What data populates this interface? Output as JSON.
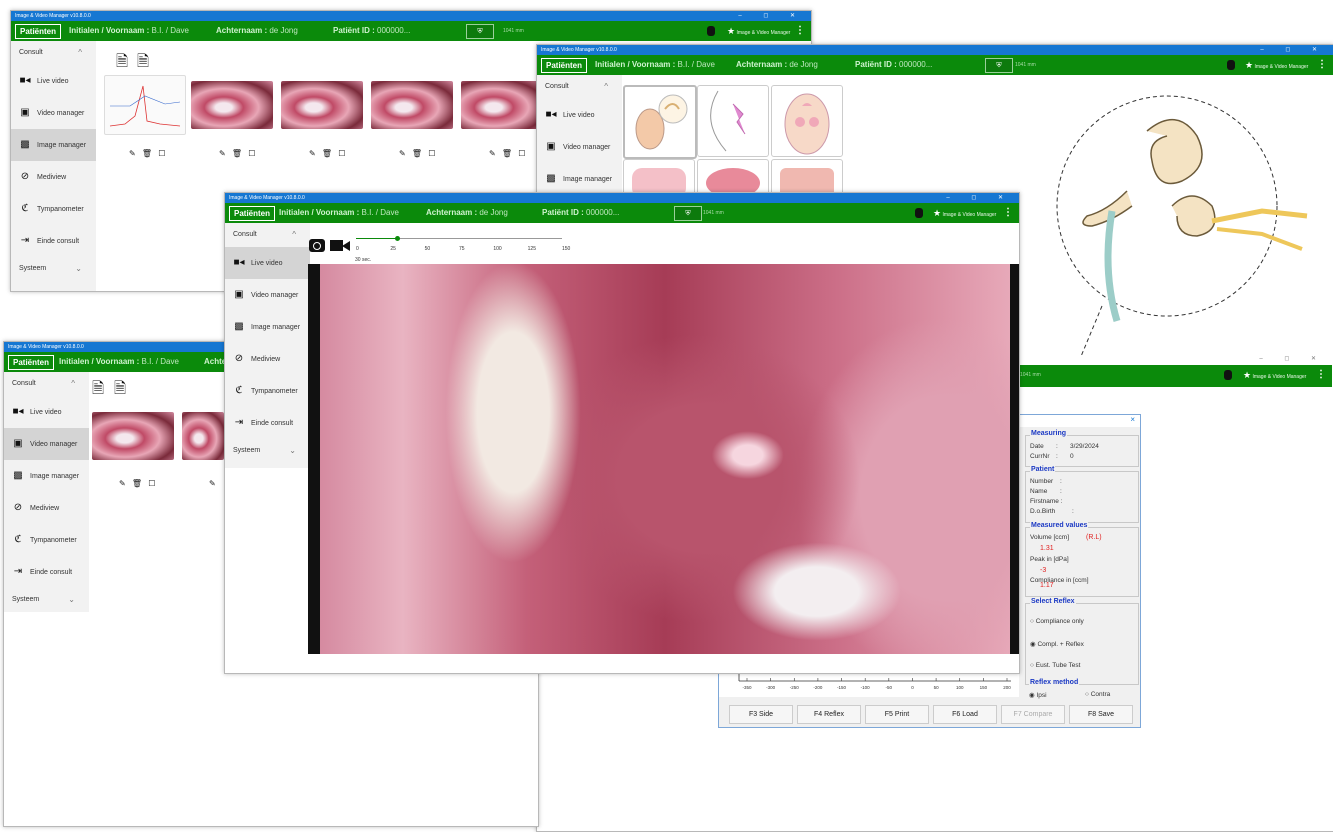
{
  "app_title": "Image & Video Manager v10.8.0.0",
  "window_controls": "– ◻ ✕",
  "header": {
    "patients_button": "Patiënten",
    "initials_label": "Initialen / Voornaam :",
    "initials_value": "B.I. / Dave",
    "lastname_label": "Achternaam :",
    "lastname_value": "de Jong",
    "patient_id_label": "Patiënt ID :",
    "patient_id_value": "000000...",
    "measure_text": "1041 mm",
    "brand_text": "Image & Video Manager"
  },
  "sidebar": {
    "section_consult": "Consult",
    "items": [
      "Live video",
      "Video manager",
      "Image manager",
      "Mediview",
      "Tympanometer",
      "Einde consult"
    ],
    "section_system": "Systeem"
  },
  "slider": {
    "ticks": [
      "0",
      "25",
      "50",
      "75",
      "100",
      "125",
      "150"
    ],
    "value_label": "30 sec.",
    "value": 30
  },
  "actions_icons": "✎ 🗑 ☐",
  "tympanometer": {
    "close": "×",
    "measuring_title": "Measuring",
    "date_label": "Date",
    "date_value": "3/29/2024",
    "currnr_label": "CurrNr",
    "currnr_value": "0",
    "patient_title": "Patient",
    "number_label": "Number",
    "name_label": "Name",
    "firstname_label": "Firstname :",
    "dobirth_label": "D.o.Birth",
    "measured_title": "Measured values",
    "volume_label": "Volume [ccm]",
    "volume_side": "(R.L)",
    "volume_value": "1.31",
    "peak_label": "Peak in [dPa]",
    "peak_value": "-3",
    "compliance_label": "Compliance in [ccm]",
    "compliance_value": "1.17",
    "select_reflex_title": "Select Reflex",
    "options": [
      "Compliance only",
      "Compl. + Reflex",
      "Eust. Tube Test"
    ],
    "selected_option": "Compl. + Reflex",
    "reflex_method_title": "Reflex method",
    "methods": [
      "Ipsi",
      "Contra"
    ],
    "selected_method": "Ipsi",
    "x_ticks": [
      "-350",
      "-300",
      "-250",
      "-200",
      "-150",
      "-100",
      "-50",
      "0",
      "50",
      "100",
      "150",
      "200"
    ],
    "function_keys": [
      "F3 Side",
      "F4 Reflex",
      "F5 Print",
      "F6 Load",
      "F7 Compare",
      "F8 Save"
    ],
    "disabled_key": "F7 Compare"
  },
  "colors": {
    "title_bar": "#1677d2",
    "header_green": "#0b8a0b",
    "sidebar_bg": "#f2f2f2",
    "selected_item": "#d4d4d4",
    "reflex_group_title": "#1b39c4",
    "value_red": "#e02020"
  }
}
